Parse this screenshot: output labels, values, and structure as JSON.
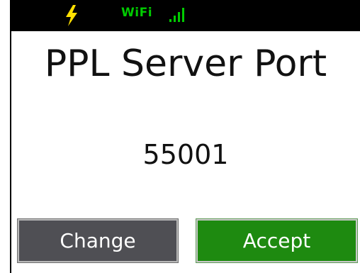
{
  "status_bar": {
    "charging_icon": "lightning-bolt-icon",
    "wifi_label": "WiFi",
    "signal_icon": "signal-bars-icon",
    "charging_color": "#ffe000",
    "wifi_color": "#00cc00"
  },
  "screen": {
    "title": "PPL Server Port",
    "value": "55001"
  },
  "buttons": {
    "change_label": "Change",
    "accept_label": "Accept",
    "change_color": "#4f4f54",
    "accept_color": "#1e8a10"
  }
}
